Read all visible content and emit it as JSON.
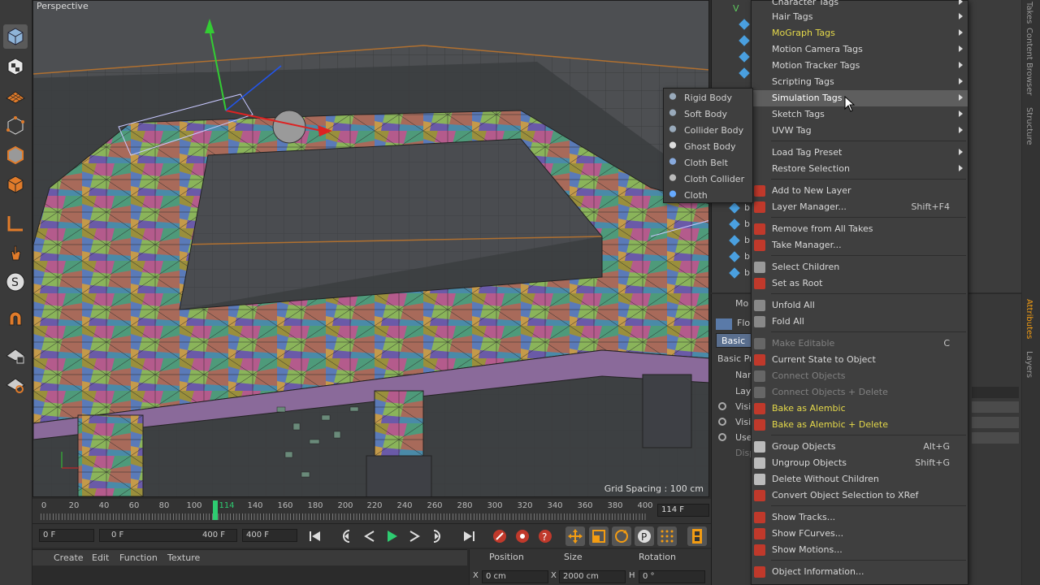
{
  "viewport": {
    "label": "Perspective",
    "grid_spacing": "Grid Spacing : 100 cm"
  },
  "timeline": {
    "ticks": [
      "0",
      "20",
      "40",
      "60",
      "80",
      "100",
      "114",
      "140",
      "160",
      "180",
      "200",
      "220",
      "240",
      "260",
      "280",
      "300",
      "320",
      "340",
      "360",
      "380",
      "400"
    ],
    "current_frame": "114 F"
  },
  "transport": {
    "start": "0 F",
    "range_start": "0 F",
    "range_end": "400 F",
    "end": "400 F"
  },
  "bottom_menu": {
    "create": "Create",
    "edit": "Edit",
    "function": "Function",
    "texture": "Texture"
  },
  "coords": {
    "position": "Position",
    "size": "Size",
    "rotation": "Rotation",
    "x_label": "X",
    "x_value": "0 cm",
    "x2_label": "X",
    "size_x": "2000 cm",
    "h_label": "H",
    "rot_h": "0 °"
  },
  "object_manager": {
    "root_letter": "V",
    "item_letter": "b"
  },
  "attr_manager": {
    "mode": "Mo",
    "object": "Flo",
    "tab_basic": "Basic",
    "section": "Basic Pr",
    "name": "Nar",
    "layer": "Lay",
    "vis1": "Visi",
    "vis2": "Visi",
    "use": "Use",
    "disp": "Disp"
  },
  "right_tabs": [
    "Takes",
    "Content Browser",
    "Structure",
    "Attributes",
    "Layers"
  ],
  "context_menu": {
    "items": [
      {
        "label": "Character Tags",
        "submenu": true
      },
      {
        "label": "Hair Tags",
        "submenu": true
      },
      {
        "label": "MoGraph Tags",
        "submenu": true,
        "style": "yellow"
      },
      {
        "label": "Motion Camera Tags",
        "submenu": true
      },
      {
        "label": "Motion Tracker Tags",
        "submenu": true
      },
      {
        "label": "Scripting Tags",
        "submenu": true
      },
      {
        "label": "Simulation Tags",
        "submenu": true,
        "style": "white",
        "highlight": true
      },
      {
        "label": "Sketch Tags",
        "submenu": true
      },
      {
        "label": "UVW Tag",
        "submenu": true
      },
      {
        "label": "Load Tag Preset",
        "submenu": true
      },
      {
        "label": "Restore Selection",
        "submenu": true
      },
      {
        "label": "Add to New Layer"
      },
      {
        "label": "Layer Manager...",
        "shortcut": "Shift+F4"
      },
      {
        "label": "Remove from All Takes"
      },
      {
        "label": "Take Manager..."
      },
      {
        "label": "Select Children"
      },
      {
        "label": "Set as Root"
      },
      {
        "label": "Unfold All"
      },
      {
        "label": "Fold All"
      },
      {
        "label": "Make Editable",
        "shortcut": "C",
        "style": "disabled"
      },
      {
        "label": "Current State to Object"
      },
      {
        "label": "Connect Objects",
        "style": "disabled"
      },
      {
        "label": "Connect Objects + Delete",
        "style": "disabled"
      },
      {
        "label": "Bake as Alembic",
        "style": "yellow"
      },
      {
        "label": "Bake as Alembic + Delete",
        "style": "yellow"
      },
      {
        "label": "Group Objects",
        "shortcut": "Alt+G"
      },
      {
        "label": "Ungroup Objects",
        "shortcut": "Shift+G"
      },
      {
        "label": "Delete Without Children"
      },
      {
        "label": "Convert Object Selection to XRef"
      },
      {
        "label": "Show Tracks..."
      },
      {
        "label": "Show FCurves..."
      },
      {
        "label": "Show Motions..."
      },
      {
        "label": "Object Information..."
      }
    ]
  },
  "submenu": {
    "items": [
      "Rigid Body",
      "Soft Body",
      "Collider Body",
      "Ghost Body",
      "Cloth Belt",
      "Cloth Collider",
      "Cloth"
    ]
  },
  "colors": {
    "menu_bg": "#3f3f3f",
    "highlight": "#5e5e5e",
    "yellow_text": "#e5d94a",
    "playhead": "#2ecc71",
    "accent_orange": "#f39c12"
  }
}
